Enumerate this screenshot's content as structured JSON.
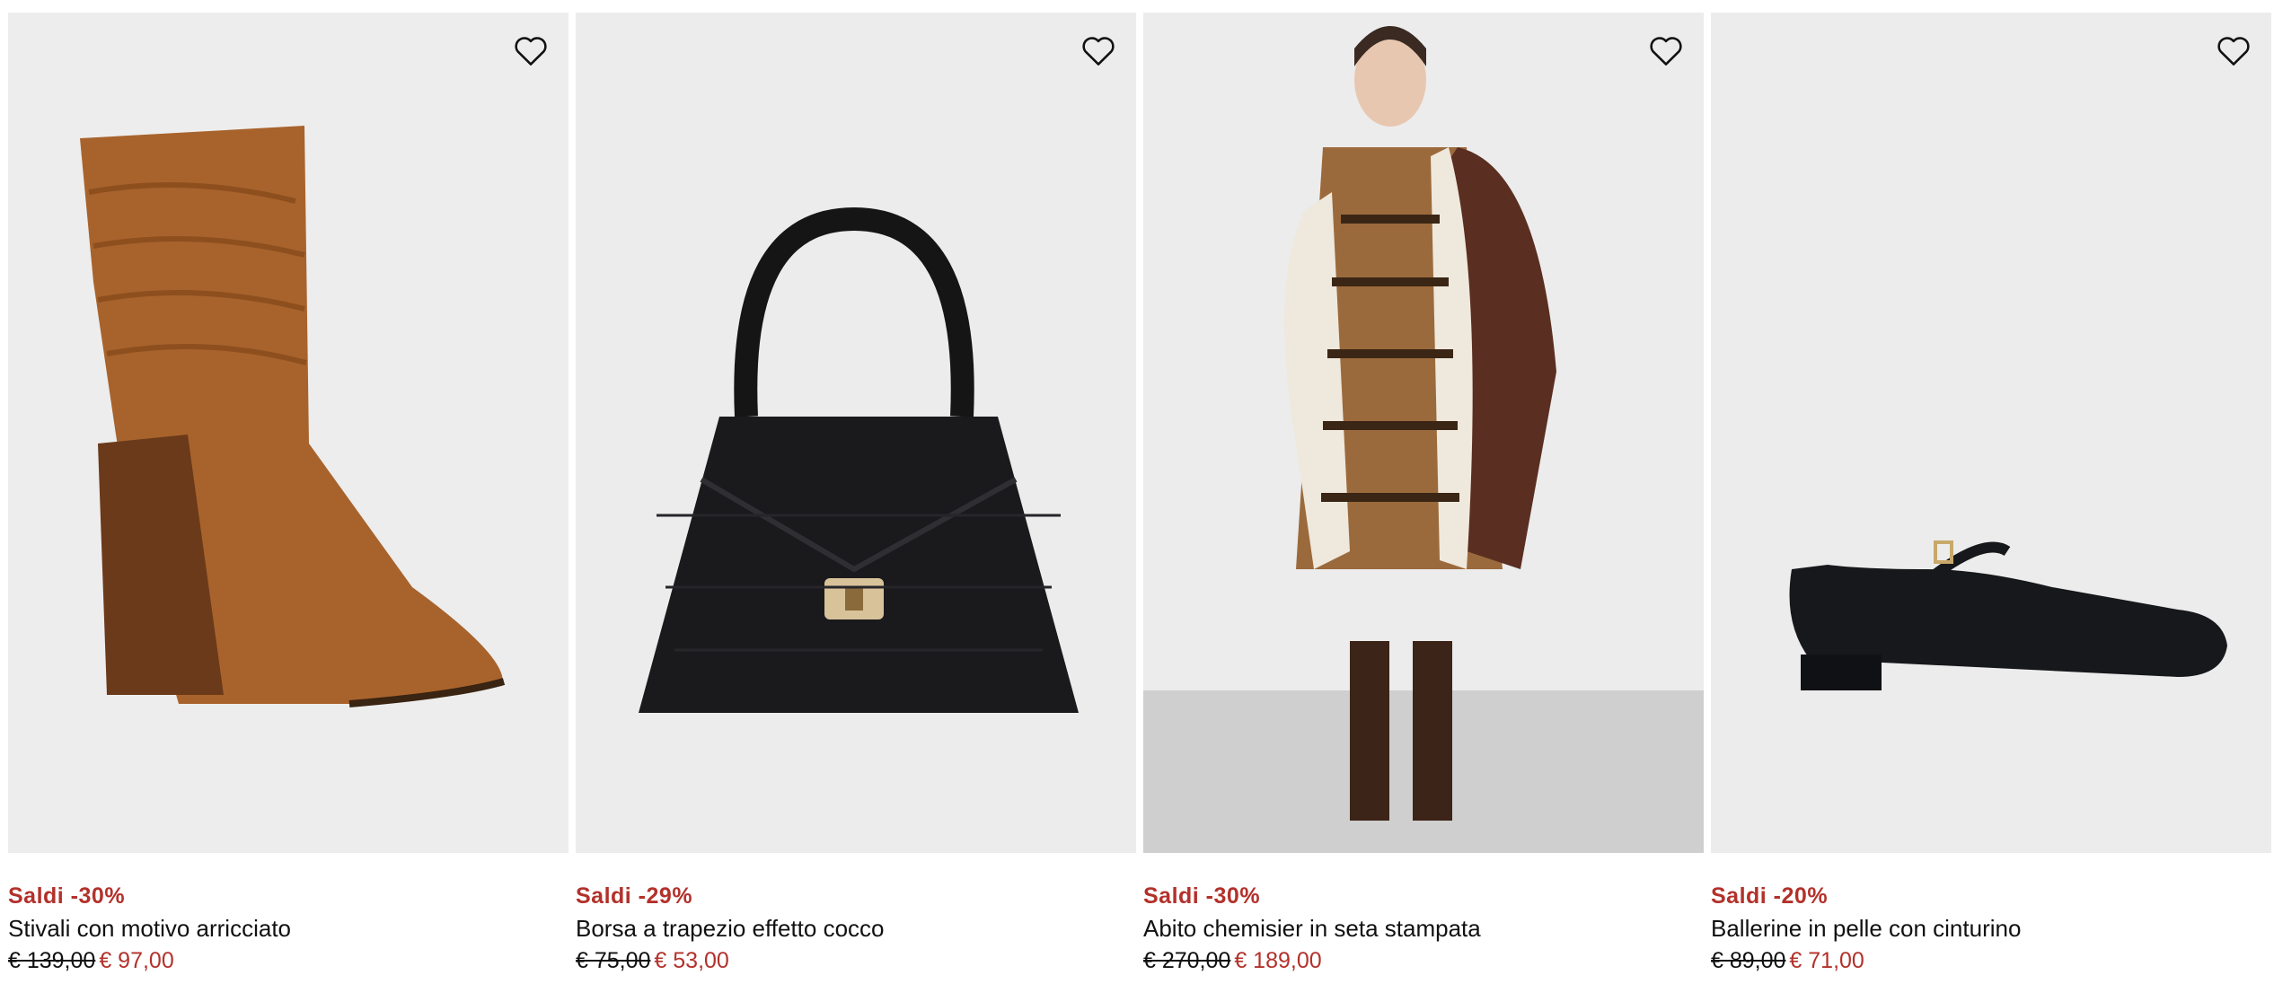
{
  "products": [
    {
      "badge": "Saldi -30%",
      "title": "Stivali con motivo arricciato",
      "old_price": "€ 139,00",
      "new_price": "€ 97,00"
    },
    {
      "badge": "Saldi -29%",
      "title": "Borsa a trapezio effetto cocco",
      "old_price": "€ 75,00",
      "new_price": "€ 53,00"
    },
    {
      "badge": "Saldi -30%",
      "title": "Abito chemisier in seta stampata",
      "old_price": "€ 270,00",
      "new_price": "€ 189,00"
    },
    {
      "badge": "Saldi -20%",
      "title": "Ballerine in pelle con cinturino",
      "old_price": "€ 89,00",
      "new_price": "€ 71,00"
    }
  ],
  "icons": {
    "wishlist": "heart-outline-icon"
  },
  "colors": {
    "sale": "#b3312b",
    "image_bg": "#ececec"
  }
}
